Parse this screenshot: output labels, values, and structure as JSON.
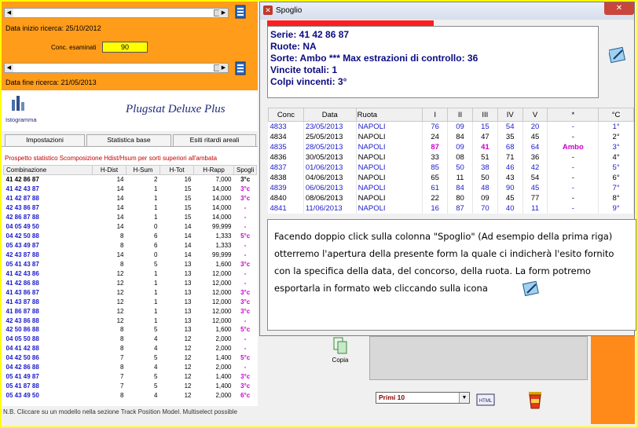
{
  "left": {
    "data_inizio": "Data inizio ricerca: 25/10/2012",
    "conc_label": "Conc. esaminati",
    "conc_value": "90",
    "data_fine": "Data fine ricerca: 21/05/2013",
    "istogramma": "Istogramma",
    "brand": "Plugstat Deluxe Plus",
    "tabs": [
      "Impostazioni",
      "Statistica base",
      "Esiti ritardi areali"
    ],
    "prospetto": "Prospetto statistico Scomposizione Hdist/Hsum per sorti superiori all'ambata",
    "headers": [
      "Combinazione",
      "H-Dist",
      "H-Sum",
      "H-Tot",
      "H-Rapp",
      "Spogli"
    ],
    "rows": [
      [
        "41 42 86 87",
        "14",
        "2",
        "16",
        "7,000",
        "3°c"
      ],
      [
        "41 42 43 87",
        "14",
        "1",
        "15",
        "14,000",
        "3°c"
      ],
      [
        "41 42 87 88",
        "14",
        "1",
        "15",
        "14,000",
        "3°c"
      ],
      [
        "42 43 86 87",
        "14",
        "1",
        "15",
        "14,000",
        "-"
      ],
      [
        "42 86 87 88",
        "14",
        "1",
        "15",
        "14,000",
        "-"
      ],
      [
        "04 05 49 50",
        "14",
        "0",
        "14",
        "99,999",
        "-"
      ],
      [
        "04 42 50 88",
        "8",
        "6",
        "14",
        "1,333",
        "5°c"
      ],
      [
        "05 43 49 87",
        "8",
        "6",
        "14",
        "1,333",
        "-"
      ],
      [
        "42 43 87 88",
        "14",
        "0",
        "14",
        "99,999",
        "-"
      ],
      [
        "05 41 43 87",
        "8",
        "5",
        "13",
        "1,600",
        "3°c"
      ],
      [
        "41 42 43 86",
        "12",
        "1",
        "13",
        "12,000",
        "-"
      ],
      [
        "41 42 86 88",
        "12",
        "1",
        "13",
        "12,000",
        "-"
      ],
      [
        "41 43 86 87",
        "12",
        "1",
        "13",
        "12,000",
        "3°c"
      ],
      [
        "41 43 87 88",
        "12",
        "1",
        "13",
        "12,000",
        "3°c"
      ],
      [
        "41 86 87 88",
        "12",
        "1",
        "13",
        "12,000",
        "3°c"
      ],
      [
        "42 43 86 88",
        "12",
        "1",
        "13",
        "12,000",
        "-"
      ],
      [
        "42 50 86 88",
        "8",
        "5",
        "13",
        "1,600",
        "5°c"
      ],
      [
        "04 05 50 88",
        "8",
        "4",
        "12",
        "2,000",
        "-"
      ],
      [
        "04 41 42 88",
        "8",
        "4",
        "12",
        "2,000",
        "-"
      ],
      [
        "04 42 50 86",
        "7",
        "5",
        "12",
        "1,400",
        "5°c"
      ],
      [
        "04 42 86 88",
        "8",
        "4",
        "12",
        "2,000",
        "-"
      ],
      [
        "05 41 49 87",
        "7",
        "5",
        "12",
        "1,400",
        "3°c"
      ],
      [
        "05 41 87 88",
        "7",
        "5",
        "12",
        "1,400",
        "3°c"
      ],
      [
        "05 43 49 50",
        "8",
        "4",
        "12",
        "2,000",
        "6°c"
      ]
    ],
    "footnote": "N.B. Cliccare su un modello nella sezione Track Position Model. Multiselect possible"
  },
  "spoglio": {
    "title": "Spoglio",
    "serie": "Serie: 41 42 86 87",
    "ruote": "Ruote: NA",
    "sorte": "Sorte: Ambo *** Max estrazioni di controllo: 36",
    "vincite": "Vincite totali: 1",
    "colpi": "Colpi vincenti: 3°",
    "headers": [
      "Conc",
      "Data",
      "Ruota",
      "I",
      "II",
      "III",
      "IV",
      "V",
      "*",
      "°C"
    ],
    "rows": [
      [
        "4833",
        "23/05/2013",
        "NAPOLI",
        "76",
        "09",
        "15",
        "54",
        "20",
        "-",
        "1°"
      ],
      [
        "4834",
        "25/05/2013",
        "NAPOLI",
        "24",
        "84",
        "47",
        "35",
        "45",
        "-",
        "2°"
      ],
      [
        "4835",
        "28/05/2013",
        "NAPOLI",
        "87",
        "09",
        "41",
        "68",
        "64",
        "Ambo",
        "3°"
      ],
      [
        "4836",
        "30/05/2013",
        "NAPOLI",
        "33",
        "08",
        "51",
        "71",
        "36",
        "-",
        "4°"
      ],
      [
        "4837",
        "01/06/2013",
        "NAPOLI",
        "85",
        "50",
        "38",
        "46",
        "42",
        "-",
        "5°"
      ],
      [
        "4838",
        "04/06/2013",
        "NAPOLI",
        "65",
        "11",
        "50",
        "43",
        "54",
        "-",
        "6°"
      ],
      [
        "4839",
        "06/06/2013",
        "NAPOLI",
        "61",
        "84",
        "48",
        "90",
        "45",
        "-",
        "7°"
      ],
      [
        "4840",
        "08/06/2013",
        "NAPOLI",
        "22",
        "80",
        "09",
        "45",
        "77",
        "-",
        "8°"
      ],
      [
        "4841",
        "11/06/2013",
        "NAPOLI",
        "16",
        "87",
        "70",
        "40",
        "11",
        "-",
        "9°"
      ]
    ]
  },
  "tooltip": {
    "text": "Facendo doppio click sulla colonna \"Spoglio\" (Ad esempio della prima riga) otterremo l'apertura della presente form la quale ci indicherà l'esito fornito con la specifica della data, del concorso, della ruota. La form potremo esportarla in formato web cliccando sulla icona"
  },
  "bottom": {
    "copia": "Copia",
    "dropdown": "Primi 10"
  }
}
